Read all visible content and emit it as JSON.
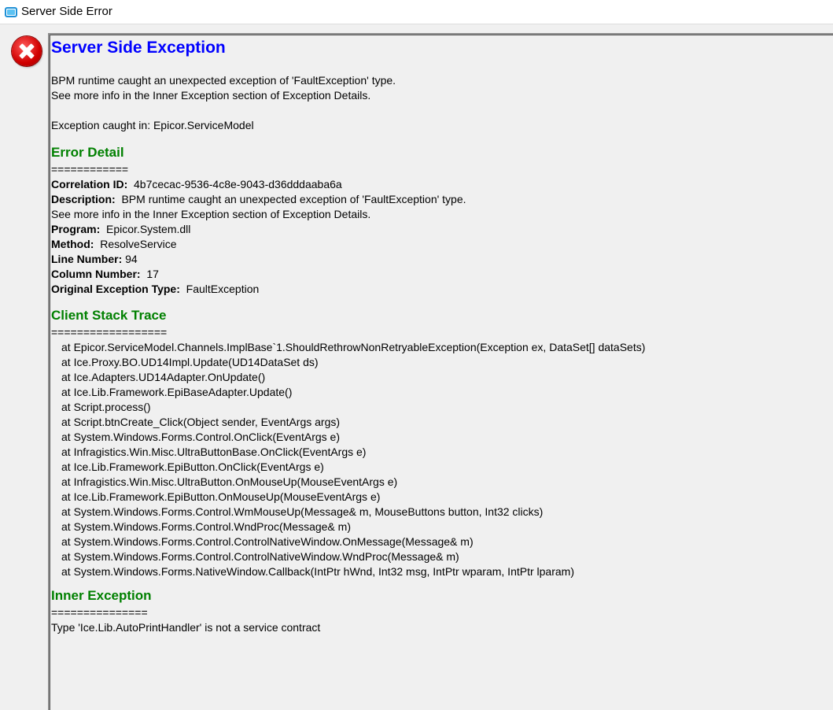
{
  "window": {
    "title": "Server Side Error"
  },
  "header": {
    "title": "Server Side Exception"
  },
  "summary": {
    "lines": [
      "BPM runtime caught an unexpected exception of 'FaultException' type.",
      "See more info in the Inner Exception section of Exception Details."
    ],
    "caught_in": "Exception caught in: Epicor.ServiceModel"
  },
  "error_detail": {
    "heading": "Error Detail",
    "separator": "============",
    "correlation_label": "Correlation ID:",
    "correlation_value": "4b7cecac-9536-4c8e-9043-d36dddaaba6a",
    "description_label": "Description:",
    "description_value": "BPM runtime caught an unexpected exception of 'FaultException' type.",
    "description_cont": "See more info in the Inner Exception section of Exception Details.",
    "program_label": "Program:",
    "program_value": "Epicor.System.dll",
    "method_label": "Method:",
    "method_value": "ResolveService",
    "line_label": "Line Number:",
    "line_value": "94",
    "column_label": "Column Number:",
    "column_value": "17",
    "type_label": "Original Exception Type:",
    "type_value": "FaultException"
  },
  "stack": {
    "heading": "Client Stack Trace",
    "separator": "==================",
    "lines": [
      "at Epicor.ServiceModel.Channels.ImplBase`1.ShouldRethrowNonRetryableException(Exception ex, DataSet[] dataSets)",
      "at Ice.Proxy.BO.UD14Impl.Update(UD14DataSet ds)",
      "at Ice.Adapters.UD14Adapter.OnUpdate()",
      "at Ice.Lib.Framework.EpiBaseAdapter.Update()",
      "at Script.process()",
      "at Script.btnCreate_Click(Object sender, EventArgs args)",
      "at System.Windows.Forms.Control.OnClick(EventArgs e)",
      "at Infragistics.Win.Misc.UltraButtonBase.OnClick(EventArgs e)",
      "at Ice.Lib.Framework.EpiButton.OnClick(EventArgs e)",
      "at Infragistics.Win.Misc.UltraButton.OnMouseUp(MouseEventArgs e)",
      "at Ice.Lib.Framework.EpiButton.OnMouseUp(MouseEventArgs e)",
      "at System.Windows.Forms.Control.WmMouseUp(Message& m, MouseButtons button, Int32 clicks)",
      "at System.Windows.Forms.Control.WndProc(Message& m)",
      "at System.Windows.Forms.Control.ControlNativeWindow.OnMessage(Message& m)",
      "at System.Windows.Forms.Control.ControlNativeWindow.WndProc(Message& m)",
      "at System.Windows.Forms.NativeWindow.Callback(IntPtr hWnd, Int32 msg, IntPtr wparam, IntPtr lparam)"
    ]
  },
  "inner": {
    "heading": "Inner Exception",
    "separator": "===============",
    "text": "Type 'Ice.Lib.AutoPrintHandler' is not a service contract"
  }
}
